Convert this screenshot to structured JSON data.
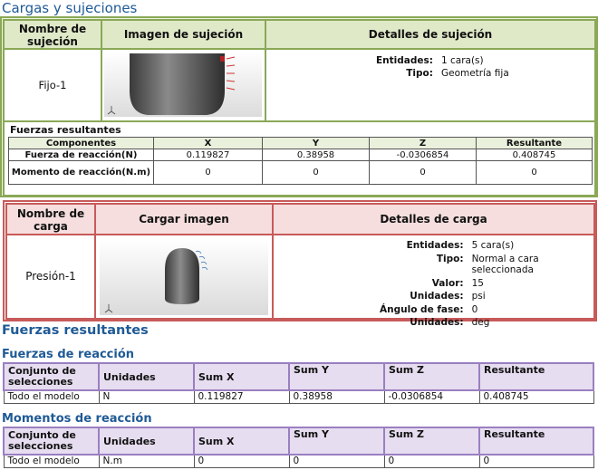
{
  "title": "Cargas y sujeciones",
  "fixture": {
    "headers": [
      "Nombre de sujeción",
      "Imagen de sujeción",
      "Detalles de sujeción"
    ],
    "name": "Fijo-1",
    "details": [
      {
        "key": "Entidades:",
        "value": "1 cara(s)"
      },
      {
        "key": "Tipo:",
        "value": "Geometría fija"
      }
    ],
    "resultant_title": "Fuerzas resultantes",
    "res_headers": [
      "Componentes",
      "X",
      "Y",
      "Z",
      "Resultante"
    ],
    "rows": [
      {
        "label": "Fuerza de reacción(N)",
        "x": "0.119827",
        "y": "0.38958",
        "z": "-0.0306854",
        "r": "0.408745"
      },
      {
        "label": "Momento de reacción(N.m)",
        "x": "0",
        "y": "0",
        "z": "0",
        "r": "0"
      }
    ]
  },
  "load": {
    "headers": [
      "Nombre de carga",
      "Cargar imagen",
      "Detalles de carga"
    ],
    "name": "Presión-1",
    "details": [
      {
        "key": "Entidades:",
        "value": "5 cara(s)"
      },
      {
        "key": "Tipo:",
        "value": "Normal a cara seleccionada"
      },
      {
        "key": "Valor:",
        "value": "15"
      },
      {
        "key": "Unidades:",
        "value": "psi"
      },
      {
        "key": "Ángulo de fase:",
        "value": "0"
      },
      {
        "key": "Unidades:",
        "value": "deg"
      }
    ]
  },
  "resultant_forces_title": "Fuerzas resultantes",
  "reaction_forces": {
    "title": "Fuerzas de reacción",
    "headers": [
      "Conjunto de selecciones",
      "Unidades",
      "Sum X",
      "Sum Y",
      "Sum Z",
      "Resultante"
    ],
    "row": [
      "Todo el modelo",
      "N",
      "0.119827",
      "0.38958",
      "-0.0306854",
      "0.408745"
    ]
  },
  "reaction_moments": {
    "title": "Momentos de reacción",
    "headers": [
      "Conjunto de selecciones",
      "Unidades",
      "Sum X",
      "Sum Y",
      "Sum Z",
      "Resultante"
    ],
    "row": [
      "Todo el modelo",
      "N.m",
      "0",
      "0",
      "0",
      "0"
    ]
  }
}
